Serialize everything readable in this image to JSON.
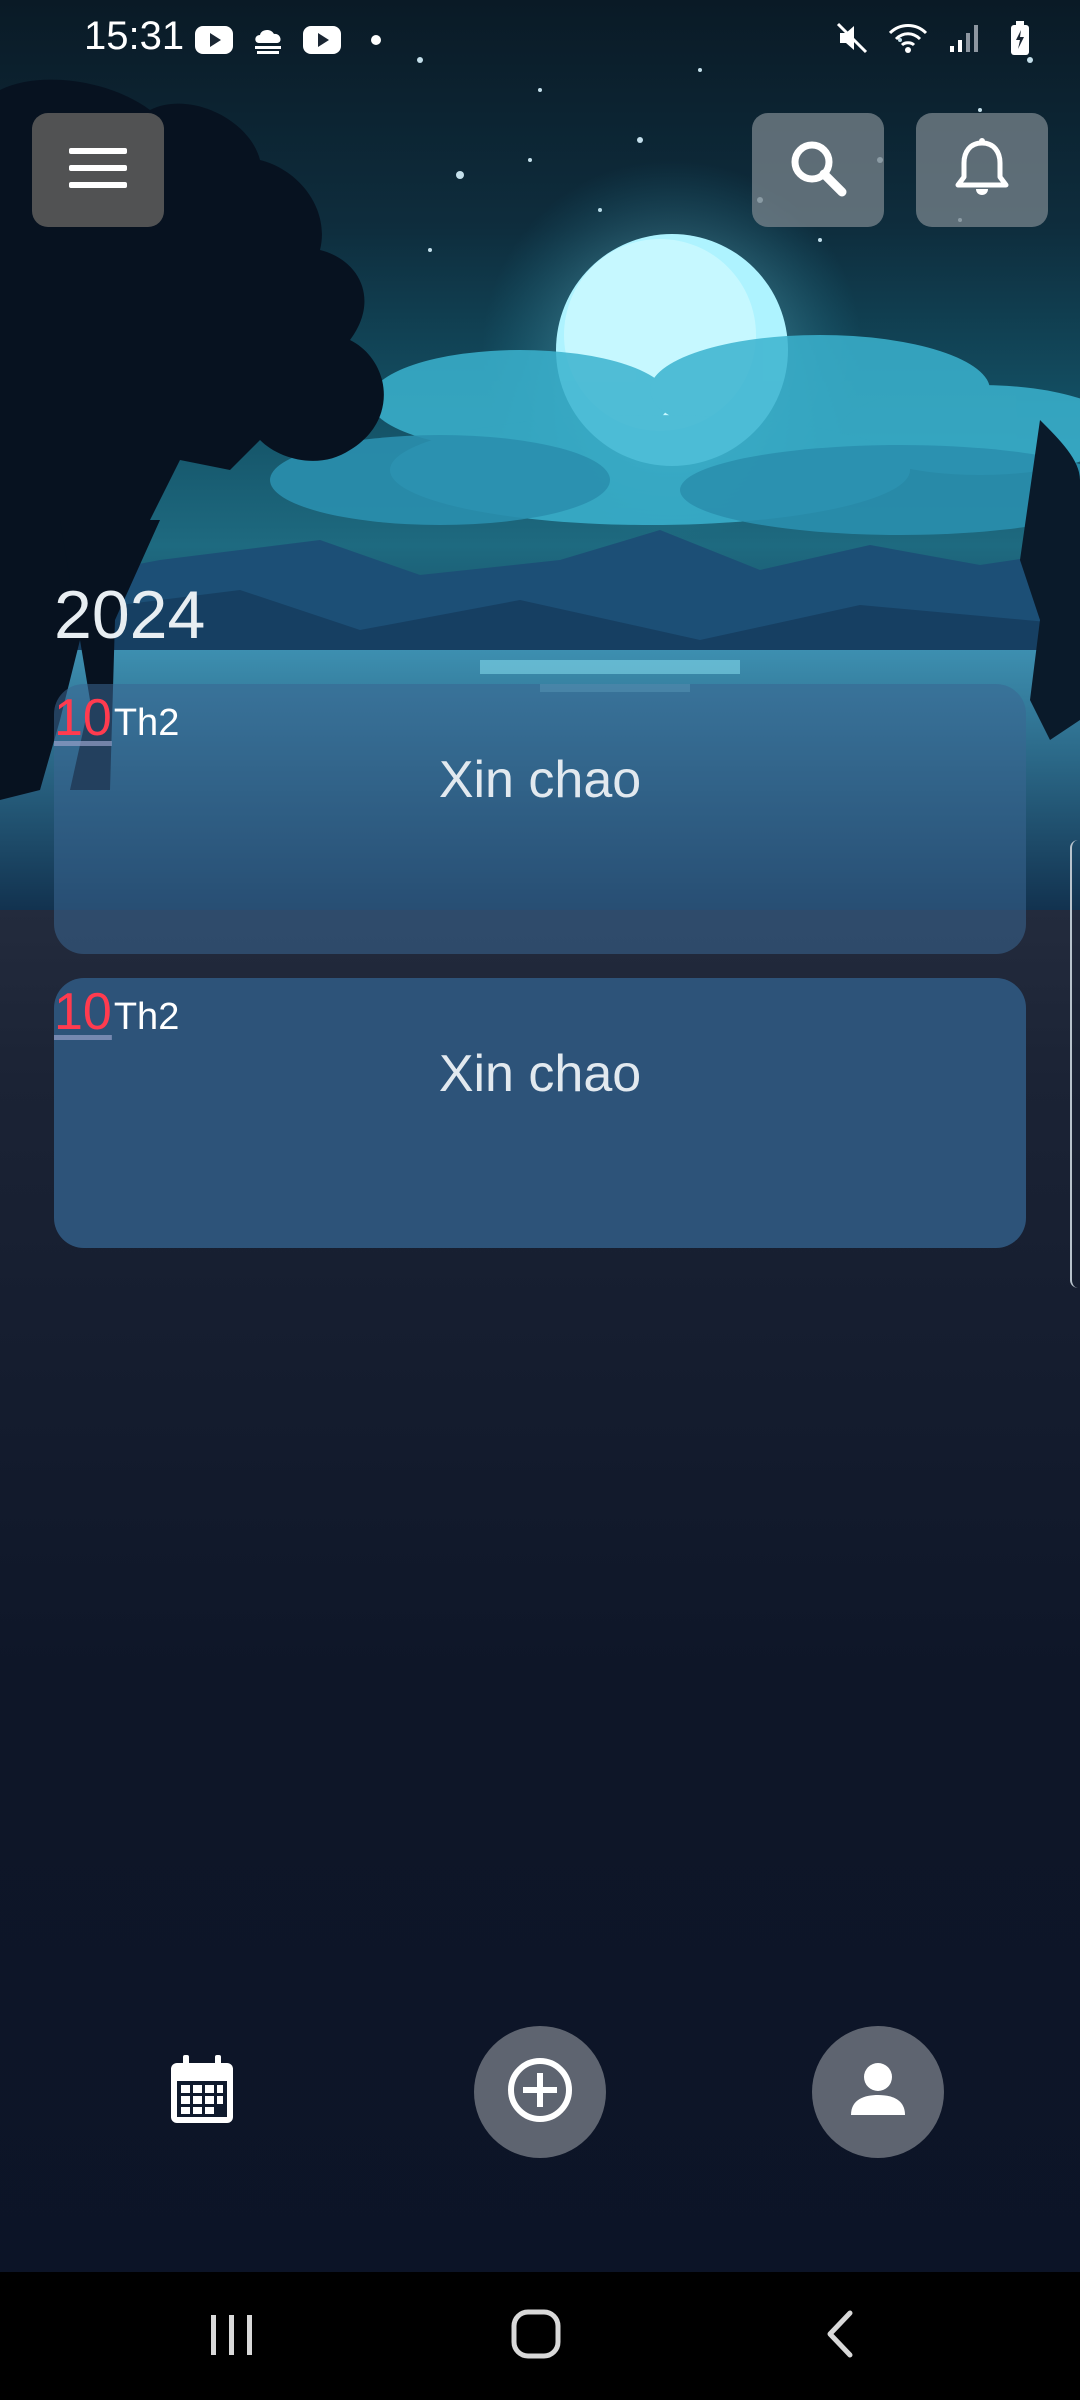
{
  "status_bar": {
    "time": "15:31",
    "left_icons": [
      "youtube-icon",
      "cloud-icon",
      "youtube-icon",
      "dot-icon"
    ],
    "right_icons": [
      "mute-icon",
      "wifi-icon",
      "signal-icon",
      "battery-icon"
    ]
  },
  "header": {
    "menu_icon": "hamburger-menu-icon",
    "search_icon": "search-icon",
    "notification_icon": "bell-icon"
  },
  "timeline": {
    "year": "2024",
    "entries": [
      {
        "day": "10",
        "month": "Th2",
        "title": "Xin chao"
      },
      {
        "day": "10",
        "month": "Th2",
        "title": "Xin chao"
      }
    ]
  },
  "bottom_nav": {
    "items": [
      {
        "icon": "calendar-icon"
      },
      {
        "icon": "add-circle-icon"
      },
      {
        "icon": "person-icon"
      }
    ]
  },
  "system_nav": [
    "recents-icon",
    "home-icon",
    "back-icon"
  ],
  "colors": {
    "date_day": "#ff3b4f",
    "card_bg": "#2d5379",
    "nav_button_bg": "#5e6470",
    "menu_button_bg": "#585858"
  }
}
